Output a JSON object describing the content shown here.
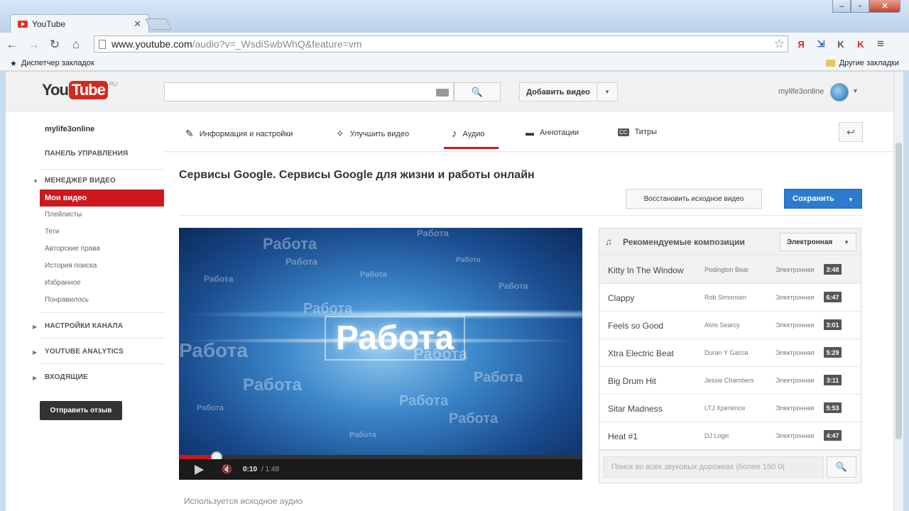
{
  "browser": {
    "tab_title": "YouTube",
    "tab_close": "✕",
    "url_host": "www.youtube.com",
    "url_path": "/audio?v=_WsdiSwbWhQ&feature=vm",
    "bookmarks_manager": "Диспетчер закладок",
    "other_bookmarks": "Другие закладки",
    "window_controls": {
      "minimize": "–",
      "maximize": "▫",
      "close": "✕"
    },
    "nav": {
      "back": "←",
      "forward": "→",
      "reload": "↻",
      "home": "⌂"
    },
    "extensions": [
      "Я",
      "⇲",
      "K",
      "K",
      "≡"
    ]
  },
  "header": {
    "logo_you": "You",
    "logo_tube": "Tube",
    "logo_region": "RU",
    "search_icon": "🔍",
    "upload_label": "Добавить видео",
    "upload_drop": "▼",
    "username": "mylife3online",
    "avatar_drop": "▼"
  },
  "sidebar": {
    "user": "mylife3online",
    "dashboard": "ПАНЕЛЬ УПРАВЛЕНИЯ",
    "video_manager": "МЕНЕДЖЕР ВИДЕО",
    "active_item": "Мои видео",
    "items": [
      "Плейлисты",
      "Теги",
      "Авторские права",
      "История поиска",
      "Избранное",
      "Понравилось"
    ],
    "channel_settings": "НАСТРОЙКИ КАНАЛА",
    "analytics": "YOUTUBE ANALYTICS",
    "inbox": "ВХОДЯЩИЕ",
    "feedback": "Отправить отзыв",
    "arrows": {
      "open": "▼",
      "closed": "▶"
    }
  },
  "editor_tabs": [
    {
      "label": "Информация и настройки",
      "icon": "✎"
    },
    {
      "label": "Улучшить видео",
      "icon": "✧"
    },
    {
      "label": "Аудио",
      "icon": "♪"
    },
    {
      "label": "Аннотации",
      "icon": "▬"
    },
    {
      "label": "Титры",
      "icon": "CC"
    }
  ],
  "undo_icon": "↩",
  "video": {
    "title": "Сервисы Google. Сервисы Google для жизни и работы онлайн",
    "restore_label": "Восстановить исходное видео",
    "save_label": "Сохранить",
    "save_drop": "▼",
    "frame_word": "Работа",
    "time_current": "0:10",
    "time_total": "/ 1:48",
    "progress": 0.093,
    "mute_icon": "🔇"
  },
  "tracks": {
    "title": "Рекомендуемые композиции",
    "music_icon": "♫",
    "genre": "Электронная",
    "genre_arrow": "▼",
    "rows": [
      {
        "title": "Kitty In The Window",
        "artist": "Podington Bear",
        "genre": "Электронная",
        "duration": "3:48"
      },
      {
        "title": "Clappy",
        "artist": "Rob Simonsen",
        "genre": "Электронная",
        "duration": "6:47"
      },
      {
        "title": "Feels so Good",
        "artist": "Alvis Searcy",
        "genre": "Электронная",
        "duration": "3:01"
      },
      {
        "title": "Xtra Electric Beat",
        "artist": "Duran Y Garcia",
        "genre": "Электронная",
        "duration": "5:29"
      },
      {
        "title": "Big Drum Hit",
        "artist": "Jessie Chambers",
        "genre": "Электронная",
        "duration": "3:11"
      },
      {
        "title": "Sitar Madness",
        "artist": "LTJ Xperience",
        "genre": "Электронная",
        "duration": "5:53"
      },
      {
        "title": "Heat #1",
        "artist": "DJ Logic",
        "genre": "Электронная",
        "duration": "4:47"
      }
    ],
    "search_placeholder": "Поиск во всех звуковых дорожках (более 150 0(",
    "search_icon": "🔍"
  },
  "audio_status": "Используется исходное аудио"
}
